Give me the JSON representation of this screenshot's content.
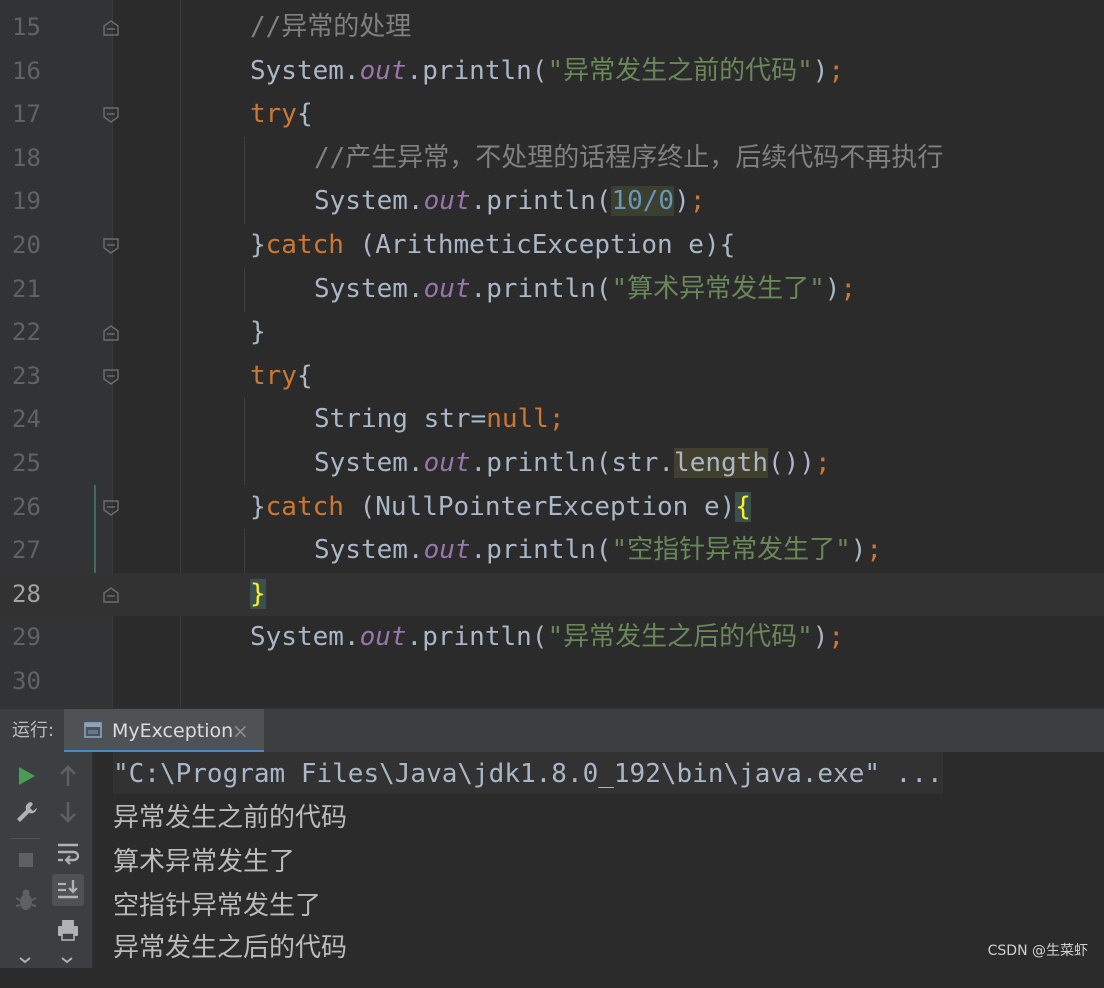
{
  "editor": {
    "lines": [
      {
        "num": "15",
        "tokens": [
          {
            "t": "//异常的处理",
            "c": "cm"
          }
        ]
      },
      {
        "num": "16",
        "tokens": [
          {
            "t": "System.",
            "c": ""
          },
          {
            "t": "out",
            "c": "fld"
          },
          {
            "t": ".println(",
            "c": ""
          },
          {
            "t": "\"异常发生之前的代码\"",
            "c": "str"
          },
          {
            "t": ")",
            "c": ""
          },
          {
            "t": ";",
            "c": "kw"
          }
        ]
      },
      {
        "num": "17",
        "tokens": [
          {
            "t": "try",
            "c": "kw"
          },
          {
            "t": "{",
            "c": ""
          }
        ]
      },
      {
        "num": "18",
        "tokens": [
          {
            "t": "//产生异常，不处理的话程序终止，后续代码不再执行",
            "c": "cm"
          }
        ]
      },
      {
        "num": "19",
        "tokens": [
          {
            "t": "System.",
            "c": ""
          },
          {
            "t": "out",
            "c": "fld"
          },
          {
            "t": ".println(",
            "c": ""
          },
          {
            "t": "10/0",
            "c": "num"
          },
          {
            "t": ")",
            "c": ""
          },
          {
            "t": ";",
            "c": "kw"
          }
        ]
      },
      {
        "num": "20",
        "tokens": [
          {
            "t": "}",
            "c": ""
          },
          {
            "t": "catch",
            "c": "kw"
          },
          {
            "t": " (ArithmeticException e){",
            "c": ""
          }
        ]
      },
      {
        "num": "21",
        "tokens": [
          {
            "t": "System.",
            "c": ""
          },
          {
            "t": "out",
            "c": "fld"
          },
          {
            "t": ".println(",
            "c": ""
          },
          {
            "t": "\"算术异常发生了\"",
            "c": "str"
          },
          {
            "t": ")",
            "c": ""
          },
          {
            "t": ";",
            "c": "kw"
          }
        ]
      },
      {
        "num": "22",
        "tokens": [
          {
            "t": "}",
            "c": ""
          }
        ]
      },
      {
        "num": "23",
        "tokens": [
          {
            "t": "try",
            "c": "kw"
          },
          {
            "t": "{",
            "c": ""
          }
        ]
      },
      {
        "num": "24",
        "tokens": [
          {
            "t": "String str=",
            "c": ""
          },
          {
            "t": "null",
            "c": "kw"
          },
          {
            "t": ";",
            "c": "kw"
          }
        ]
      },
      {
        "num": "25",
        "tokens": [
          {
            "t": "System.",
            "c": ""
          },
          {
            "t": "out",
            "c": "fld"
          },
          {
            "t": ".println(str.",
            "c": ""
          },
          {
            "t": "length",
            "c": "hl"
          },
          {
            "t": "())",
            "c": ""
          },
          {
            "t": ";",
            "c": "kw"
          }
        ]
      },
      {
        "num": "26",
        "tokens": [
          {
            "t": "}",
            "c": ""
          },
          {
            "t": "catch",
            "c": "kw"
          },
          {
            "t": " (NullPointerException e)",
            "c": ""
          },
          {
            "t": "{",
            "c": "brace"
          }
        ]
      },
      {
        "num": "27",
        "tokens": [
          {
            "t": "System.",
            "c": ""
          },
          {
            "t": "out",
            "c": "fld"
          },
          {
            "t": ".println(",
            "c": ""
          },
          {
            "t": "\"空指针异常发生了\"",
            "c": "str"
          },
          {
            "t": ")",
            "c": ""
          },
          {
            "t": ";",
            "c": "kw"
          }
        ]
      },
      {
        "num": "28",
        "tokens": [
          {
            "t": "}",
            "c": "brace"
          }
        ]
      },
      {
        "num": "29",
        "tokens": [
          {
            "t": "System.",
            "c": ""
          },
          {
            "t": "out",
            "c": "fld"
          },
          {
            "t": ".println(",
            "c": ""
          },
          {
            "t": "\"异常发生之后的代码\"",
            "c": "str"
          },
          {
            "t": ")",
            "c": ""
          },
          {
            "t": ";",
            "c": "kw"
          }
        ]
      },
      {
        "num": "30",
        "tokens": []
      }
    ]
  },
  "run_panel": {
    "label": "运行:",
    "tab_label": "MyException",
    "tab_close": "×",
    "toolbar_icons": [
      "run-icon",
      "rerun-up-icon",
      "wrench-icon",
      "scroll-down-icon",
      "stop-icon",
      "soft-wrap-icon",
      "debug-bug-icon",
      "scroll-to-end-icon",
      "print-icon",
      "more-icon"
    ]
  },
  "console": {
    "command": "\"C:\\Program Files\\Java\\jdk1.8.0_192\\bin\\java.exe\" ...",
    "output": [
      "异常发生之前的代码",
      "算术异常发生了",
      "空指针异常发生了",
      "异常发生之后的代码"
    ]
  },
  "watermark": "CSDN @生菜虾",
  "colors": {
    "keyword": "#cc7832",
    "string": "#6a8759",
    "comment": "#808080",
    "field": "#9876aa",
    "number": "#6897bb",
    "brace_match": "#ffef28",
    "run_green": "#499c54"
  }
}
